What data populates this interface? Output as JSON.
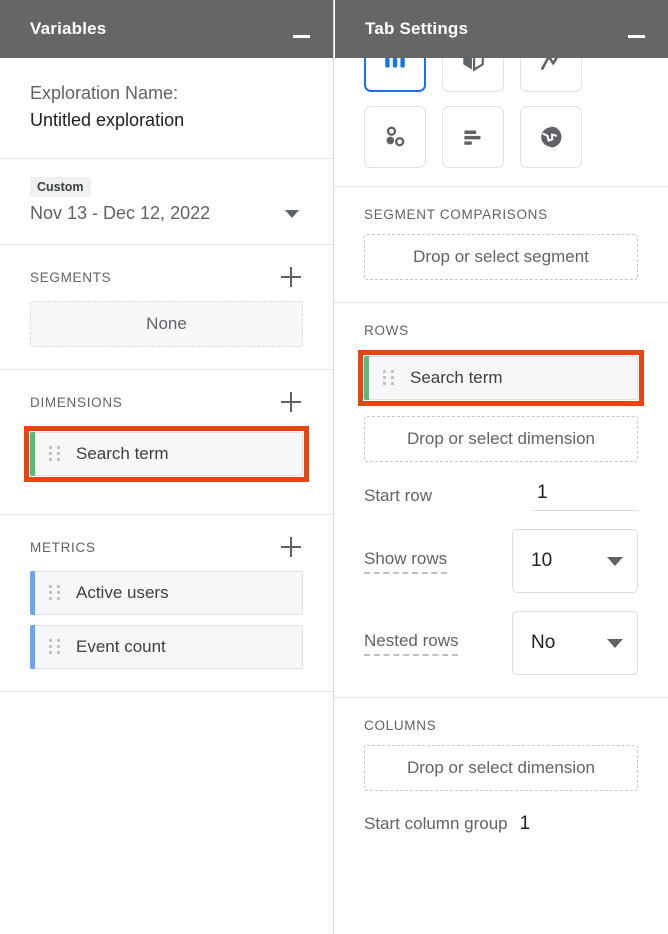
{
  "variables_panel": {
    "title": "Variables",
    "minimize_icon": "minimize-icon",
    "exploration": {
      "caption": "Exploration Name:",
      "value": "Untitled exploration"
    },
    "date_range": {
      "badge": "Custom",
      "value": "Nov 13 - Dec 12, 2022",
      "caret_icon": "chevron-down-icon"
    },
    "segments": {
      "label": "SEGMENTS",
      "add_icon": "plus-icon",
      "empty_label": "None"
    },
    "dimensions": {
      "label": "DIMENSIONS",
      "add_icon": "plus-icon",
      "items": [
        {
          "label": "Search term",
          "accent": "#57bb79",
          "highlighted": true
        }
      ]
    },
    "metrics": {
      "label": "METRICS",
      "add_icon": "plus-icon",
      "items": [
        {
          "label": "Active users",
          "accent": "#6ba4f0"
        },
        {
          "label": "Event count",
          "accent": "#6ba4f0"
        }
      ]
    }
  },
  "tab_settings_panel": {
    "title": "Tab Settings",
    "minimize_icon": "minimize-icon",
    "techniques": [
      {
        "name": "free-form-table-icon",
        "selected": true
      },
      {
        "name": "funnel-exploration-icon",
        "selected": false
      },
      {
        "name": "path-exploration-icon",
        "selected": false
      },
      {
        "name": "segment-overlap-icon",
        "selected": false
      },
      {
        "name": "bar-chart-icon",
        "selected": false
      },
      {
        "name": "geo-map-icon",
        "selected": false
      }
    ],
    "segment_comparisons": {
      "label": "SEGMENT COMPARISONS",
      "drop_placeholder": "Drop or select segment"
    },
    "rows": {
      "label": "ROWS",
      "items": [
        {
          "label": "Search term",
          "accent": "#57bb79",
          "highlighted": true
        }
      ],
      "drop_placeholder": "Drop or select dimension",
      "start_row": {
        "label": "Start row",
        "value": "1"
      },
      "show_rows": {
        "label": "Show rows",
        "value": "10",
        "caret_icon": "chevron-down-icon"
      },
      "nested_rows": {
        "label": "Nested rows",
        "value": "No",
        "caret_icon": "chevron-down-icon"
      }
    },
    "columns": {
      "label": "COLUMNS",
      "drop_placeholder": "Drop or select dimension",
      "start_column_group": {
        "label": "Start column group",
        "value": "1"
      }
    }
  },
  "colors": {
    "header_bg": "#666666",
    "highlight": "#ea4412",
    "dimension_accent": "#57bb79",
    "metric_accent": "#6ba4f0",
    "selected_blue": "#1a73e8"
  }
}
